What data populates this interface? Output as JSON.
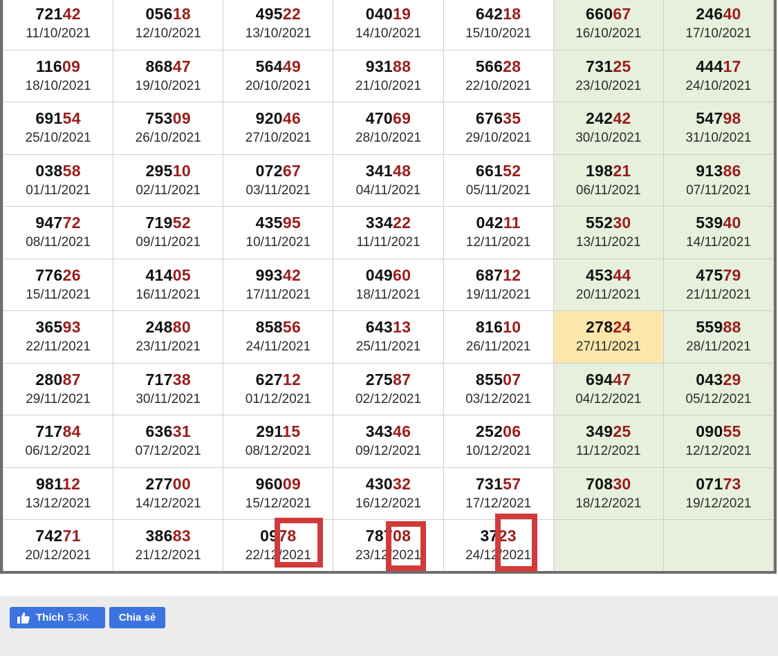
{
  "colors": {
    "last_two_digits": "#9b1c1c",
    "weekend_bg": "#e6f0dc",
    "highlight_bg": "#fbe7a9",
    "mark_red": "#d23a3a",
    "facebook_blue": "#3b73e0"
  },
  "rows": [
    [
      {
        "prefix": "721",
        "tail": "42",
        "date": "11/10/2021"
      },
      {
        "prefix": "056",
        "tail": "18",
        "date": "12/10/2021"
      },
      {
        "prefix": "495",
        "tail": "22",
        "date": "13/10/2021"
      },
      {
        "prefix": "040",
        "tail": "19",
        "date": "14/10/2021"
      },
      {
        "prefix": "642",
        "tail": "18",
        "date": "15/10/2021"
      },
      {
        "prefix": "660",
        "tail": "67",
        "date": "16/10/2021"
      },
      {
        "prefix": "246",
        "tail": "40",
        "date": "17/10/2021"
      }
    ],
    [
      {
        "prefix": "116",
        "tail": "09",
        "date": "18/10/2021"
      },
      {
        "prefix": "868",
        "tail": "47",
        "date": "19/10/2021"
      },
      {
        "prefix": "564",
        "tail": "49",
        "date": "20/10/2021"
      },
      {
        "prefix": "931",
        "tail": "88",
        "date": "21/10/2021"
      },
      {
        "prefix": "566",
        "tail": "28",
        "date": "22/10/2021"
      },
      {
        "prefix": "731",
        "tail": "25",
        "date": "23/10/2021"
      },
      {
        "prefix": "444",
        "tail": "17",
        "date": "24/10/2021"
      }
    ],
    [
      {
        "prefix": "691",
        "tail": "54",
        "date": "25/10/2021"
      },
      {
        "prefix": "753",
        "tail": "09",
        "date": "26/10/2021"
      },
      {
        "prefix": "920",
        "tail": "46",
        "date": "27/10/2021"
      },
      {
        "prefix": "470",
        "tail": "69",
        "date": "28/10/2021"
      },
      {
        "prefix": "676",
        "tail": "35",
        "date": "29/10/2021"
      },
      {
        "prefix": "242",
        "tail": "42",
        "date": "30/10/2021"
      },
      {
        "prefix": "547",
        "tail": "98",
        "date": "31/10/2021"
      }
    ],
    [
      {
        "prefix": "038",
        "tail": "58",
        "date": "01/11/2021"
      },
      {
        "prefix": "295",
        "tail": "10",
        "date": "02/11/2021"
      },
      {
        "prefix": "072",
        "tail": "67",
        "date": "03/11/2021"
      },
      {
        "prefix": "341",
        "tail": "48",
        "date": "04/11/2021"
      },
      {
        "prefix": "661",
        "tail": "52",
        "date": "05/11/2021"
      },
      {
        "prefix": "198",
        "tail": "21",
        "date": "06/11/2021"
      },
      {
        "prefix": "913",
        "tail": "86",
        "date": "07/11/2021"
      }
    ],
    [
      {
        "prefix": "947",
        "tail": "72",
        "date": "08/11/2021"
      },
      {
        "prefix": "719",
        "tail": "52",
        "date": "09/11/2021"
      },
      {
        "prefix": "435",
        "tail": "95",
        "date": "10/11/2021"
      },
      {
        "prefix": "334",
        "tail": "22",
        "date": "11/11/2021"
      },
      {
        "prefix": "042",
        "tail": "11",
        "date": "12/11/2021"
      },
      {
        "prefix": "552",
        "tail": "30",
        "date": "13/11/2021"
      },
      {
        "prefix": "539",
        "tail": "40",
        "date": "14/11/2021"
      }
    ],
    [
      {
        "prefix": "776",
        "tail": "26",
        "date": "15/11/2021"
      },
      {
        "prefix": "414",
        "tail": "05",
        "date": "16/11/2021"
      },
      {
        "prefix": "993",
        "tail": "42",
        "date": "17/11/2021"
      },
      {
        "prefix": "049",
        "tail": "60",
        "date": "18/11/2021"
      },
      {
        "prefix": "687",
        "tail": "12",
        "date": "19/11/2021"
      },
      {
        "prefix": "453",
        "tail": "44",
        "date": "20/11/2021"
      },
      {
        "prefix": "475",
        "tail": "79",
        "date": "21/11/2021"
      }
    ],
    [
      {
        "prefix": "365",
        "tail": "93",
        "date": "22/11/2021"
      },
      {
        "prefix": "248",
        "tail": "80",
        "date": "23/11/2021"
      },
      {
        "prefix": "858",
        "tail": "56",
        "date": "24/11/2021"
      },
      {
        "prefix": "643",
        "tail": "13",
        "date": "25/11/2021"
      },
      {
        "prefix": "816",
        "tail": "10",
        "date": "26/11/2021"
      },
      {
        "prefix": "278",
        "tail": "24",
        "date": "27/11/2021",
        "highlight": true
      },
      {
        "prefix": "559",
        "tail": "88",
        "date": "28/11/2021"
      }
    ],
    [
      {
        "prefix": "280",
        "tail": "87",
        "date": "29/11/2021"
      },
      {
        "prefix": "717",
        "tail": "38",
        "date": "30/11/2021"
      },
      {
        "prefix": "627",
        "tail": "12",
        "date": "01/12/2021"
      },
      {
        "prefix": "275",
        "tail": "87",
        "date": "02/12/2021"
      },
      {
        "prefix": "855",
        "tail": "07",
        "date": "03/12/2021"
      },
      {
        "prefix": "694",
        "tail": "47",
        "date": "04/12/2021"
      },
      {
        "prefix": "043",
        "tail": "29",
        "date": "05/12/2021"
      }
    ],
    [
      {
        "prefix": "717",
        "tail": "84",
        "date": "06/12/2021"
      },
      {
        "prefix": "636",
        "tail": "31",
        "date": "07/12/2021"
      },
      {
        "prefix": "291",
        "tail": "15",
        "date": "08/12/2021"
      },
      {
        "prefix": "343",
        "tail": "46",
        "date": "09/12/2021"
      },
      {
        "prefix": "252",
        "tail": "06",
        "date": "10/12/2021"
      },
      {
        "prefix": "349",
        "tail": "25",
        "date": "11/12/2021"
      },
      {
        "prefix": "090",
        "tail": "55",
        "date": "12/12/2021"
      }
    ],
    [
      {
        "prefix": "981",
        "tail": "12",
        "date": "13/12/2021"
      },
      {
        "prefix": "277",
        "tail": "00",
        "date": "14/12/2021"
      },
      {
        "prefix": "960",
        "tail": "09",
        "date": "15/12/2021"
      },
      {
        "prefix": "430",
        "tail": "32",
        "date": "16/12/2021"
      },
      {
        "prefix": "731",
        "tail": "57",
        "date": "17/12/2021"
      },
      {
        "prefix": "708",
        "tail": "30",
        "date": "18/12/2021"
      },
      {
        "prefix": "071",
        "tail": "73",
        "date": "19/12/2021"
      }
    ],
    [
      {
        "prefix": "742",
        "tail": "71",
        "date": "20/12/2021"
      },
      {
        "prefix": "386",
        "tail": "83",
        "date": "21/12/2021"
      },
      {
        "prefix": "09",
        "tail": "78",
        "date": "22/12/2021"
      },
      {
        "prefix": "787",
        "tail": "08",
        "date": "23/12/2021"
      },
      {
        "prefix": "37",
        "tail": "23",
        "date": "24/12/2021"
      },
      {
        "prefix": "",
        "tail": "",
        "date": ""
      },
      {
        "prefix": "",
        "tail": "",
        "date": ""
      }
    ]
  ],
  "footer": {
    "like_label": "Thích",
    "like_count": "5,3K",
    "share_label": "Chia sẻ",
    "like_icon": "thumbs-up-icon"
  }
}
